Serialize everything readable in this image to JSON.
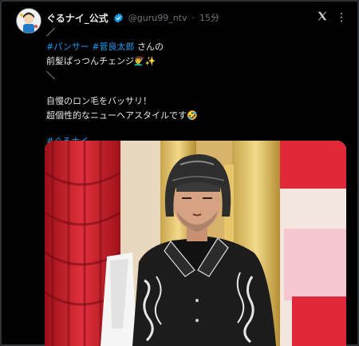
{
  "post": {
    "display_name": "ぐるナイ_公式",
    "handle": "@guru99_ntv",
    "dot": "·",
    "time": "15分",
    "lines": {
      "l1": "／",
      "l2_tag1": "#パンサー",
      "l2_tag2": "#菅良太郎",
      "l2_rest": " さんの",
      "l3": "前髪ぱっつんチェンジ💇‍♂️✨",
      "l4": "＼",
      "l5": "自慢のロン毛をバッサリ！",
      "l6": "超個性的なニューヘアスタイルです🤣",
      "l7_tag": "#ぐるナイ"
    }
  },
  "icons": {
    "verified": "verified-badge-icon",
    "logo": "x-logo-icon",
    "more": "more-options-icon"
  },
  "colors": {
    "link": "#1d9bf0",
    "verified": "#1d9bf0",
    "background": "#000000"
  }
}
